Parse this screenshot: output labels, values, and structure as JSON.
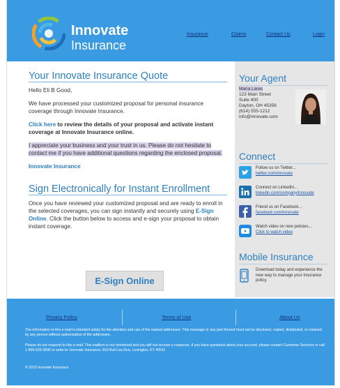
{
  "header": {
    "brand_line1": "Innovate",
    "brand_line2": "Insurance",
    "nav": [
      "Insurance",
      "Claims",
      "Contact Us",
      "Login"
    ]
  },
  "quote": {
    "title": "Your Innovate Insurance Quote",
    "greeting": "Hello Eli B Good,",
    "para1": "We have processed your customized proposal for personal insurance coverage through Innovate Insurance.",
    "click_link": "Click here",
    "click_rest": " to review the details of your proposal and activate instant coverage at Innovate Insurance online.",
    "para3": "I appreciate your business and your trust in us. Please do not hesitate to contact me if you have additional questions regarding the enclosed proposal.",
    "signature": "Innovate Insurance"
  },
  "sign": {
    "title": "Sign Electronically for Instant Enrollment",
    "text_before": "Once you have reviewed your customized proposal and are ready to enroll in the selected coverages, you can sign instantly and securely using ",
    "text_link": "E-Sign Online",
    "text_after": ". Click the button below to access and e-sign your proposal to obtain instant coverage.",
    "button": "E-Sign Online"
  },
  "agent": {
    "title": "Your Agent",
    "name": "Maria Lares",
    "address1": "123 Main Street",
    "address2": "Suite 400",
    "city": "Dayton, OH 45356",
    "phone": "(614) 555-1212",
    "email": "info@innovate.com"
  },
  "connect": {
    "title": "Connect",
    "items": [
      {
        "icon": "twitter-icon",
        "text": "Follow us on Twitter...",
        "link": "twitter.com/innovate",
        "color": "#2aa3e6"
      },
      {
        "icon": "linkedin-icon",
        "text": "Connect on LinkedIn...",
        "link": "linkedin.com/company/innovate",
        "color": "#1c6fae"
      },
      {
        "icon": "facebook-icon",
        "text": "Friend us on Facebook...",
        "link": "facebook.com/innovate",
        "color": "#3b5fa8"
      },
      {
        "icon": "video-icon",
        "text": "Watch video on new policies...",
        "link": "Click to watch video",
        "color": "#1f8be0"
      }
    ]
  },
  "mobile": {
    "title": "Mobile Insurance",
    "text": "Download today and experience the new way to manage your insurance policy."
  },
  "footer": {
    "links": [
      "Privacy Policy",
      "Terms of Use",
      "About Us"
    ],
    "disclaimer": "The information in this e-mail is intended solely for the attention and use of the named addressee. This message or any part thereof must not be disclosed, copied, distributed, or retained by any person without authorization of the addressee.",
    "noreply": "Please do not respond to this e-mail. This mailbox is not monitored and you will not receive a response. If you have questions about your account, please contact Customer Services or call 1-800-633-3600 or write to: Innovate Insurance, 810 Bull Lea Run, Lexington, KY 40511",
    "copyright": "© 2019 Innovate Insurance"
  }
}
